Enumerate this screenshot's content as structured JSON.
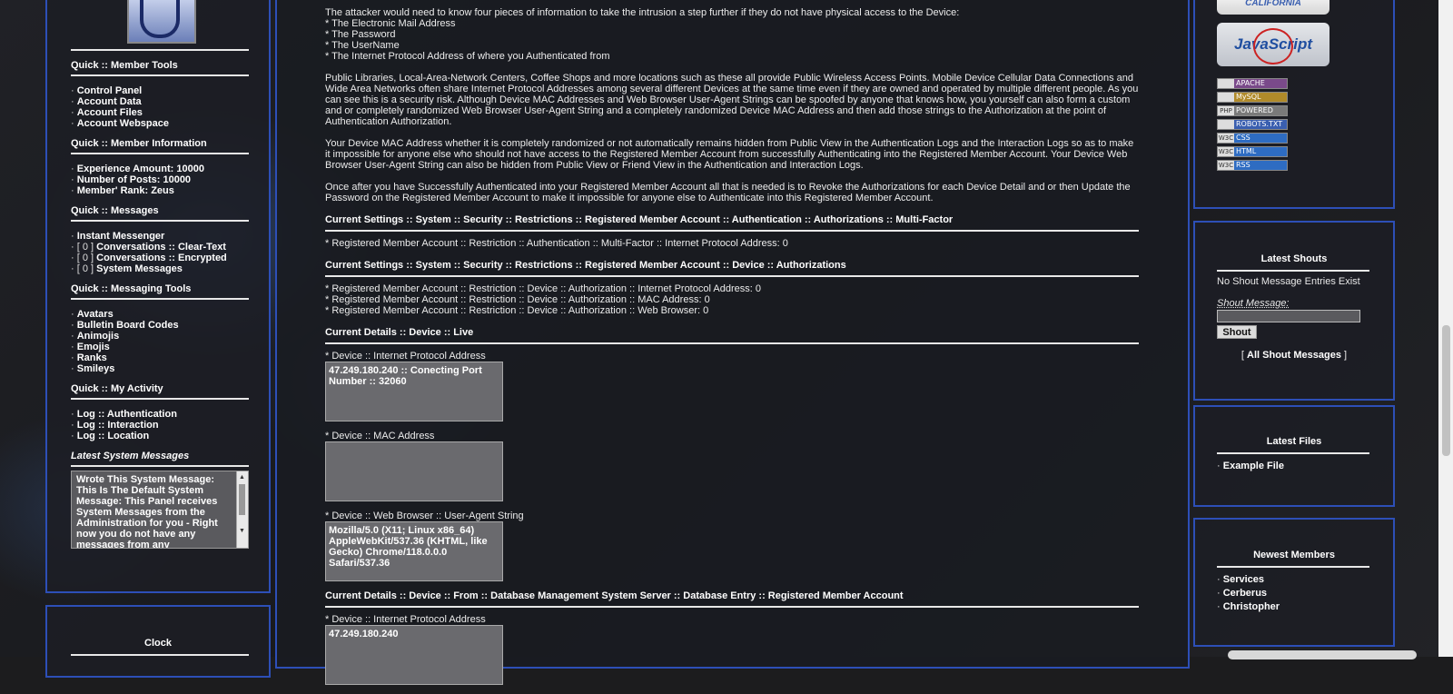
{
  "left": {
    "member_tools": {
      "title": "Quick :: Member Tools",
      "items": [
        "Control Panel",
        "Account Data",
        "Account Files",
        "Account Webspace"
      ]
    },
    "member_info": {
      "title": "Quick :: Member Information",
      "items": [
        "Experience Amount: 10000",
        "Number of Posts: 10000",
        "Member' Rank: Zeus"
      ]
    },
    "messages": {
      "title": "Quick :: Messages",
      "instant": "Instant Messenger",
      "clear": {
        "count": "[ 0 ]",
        "label": "Conversations :: Clear-Text"
      },
      "encrypted": {
        "count": "[ 0 ]",
        "label": "Conversations :: Encrypted"
      },
      "system": {
        "count": "[ 0 ]",
        "label": "System Messages"
      }
    },
    "messaging_tools": {
      "title": "Quick :: Messaging Tools",
      "items": [
        "Avatars",
        "Bulletin Board Codes",
        "Animojis",
        "Emojis",
        "Ranks",
        "Smileys"
      ]
    },
    "activity": {
      "title": "Quick :: My Activity",
      "items": [
        "Log :: Authentication",
        "Log :: Interaction",
        "Log :: Location"
      ]
    },
    "system_messages": {
      "title": "Latest System Messages",
      "text": "Wrote This System Message: This Is The Default System Message: This Panel receives System Messages from the Administration for you - Right now you do not have any messages from any"
    },
    "clock_title": "Clock"
  },
  "content": {
    "intro": "The attacker would need to know four pieces of information to take the intrusion a step further if they do not have physical access to the Device:",
    "bullets": [
      "* The Electronic Mail Address",
      "* The Password",
      "* The UserName",
      "* The Internet Protocol Address of where you Authenticated from"
    ],
    "para_public": "Public Libraries, Local-Area-Network Centers, Coffee Shops and more locations such as these all provide Public Wireless Access Points. Mobile Device Cellular Data Connections and Wide Area Networks often share Internet Protocol Addresses among several different Devices at the same time even if they are owned and operated by multiple different people. As you can see this is a security risk. Although Device MAC Addresses and Web Browser User-Agent Strings can be spoofed by anyone that knows how, you yourself can also form a custom and or completely randomized Web Browser User-Agent String and a completely randomized Device MAC Address and then add those strings to the Authorization at the point of Authentication Authorization.",
    "para_mac": "Your Device MAC Address whether it is completely randomized or not automatically remains hidden from Public View in the Authentication Logs and the Interaction Logs so as to make it impossible for anyone else who should not have access to the Registered Member Account from successfully Authenticating into the Registered Member Account. Your Device Web Browser User-Agent String can also be hidden from Public View or Friend View in the Authentication and Interaction Logs.",
    "para_once": "Once after you have Successfully Authenticated into your Registered Member Account all that is needed is to Revoke the Authorizations for each Device Detail and or then Update the Password on the Registered Member Account to make it impossible for anyone else to Authenticate into this Registered Member Account.",
    "hdr_multifactor": "Current Settings :: System :: Security :: Restrictions :: Registered Member Account :: Authentication :: Authorizations :: Multi-Factor",
    "multifactor_line": "* Registered Member Account :: Restriction :: Authentication :: Multi-Factor :: Internet Protocol Address: 0",
    "hdr_device_auth": "Current Settings :: System :: Security :: Restrictions :: Registered Member Account :: Device :: Authorizations",
    "device_auth_lines": [
      "* Registered Member Account :: Restriction :: Device :: Authorization :: Internet Protocol Address: 0",
      "* Registered Member Account :: Restriction :: Device :: Authorization :: MAC Address: 0",
      "* Registered Member Account :: Restriction :: Device :: Authorization :: Web Browser: 0"
    ],
    "hdr_live": "Current Details :: Device :: Live",
    "live_ip_label": "* Device :: Internet Protocol Address",
    "live_ip_value": "47.249.180.240 :: Conecting Port Number :: 32060",
    "live_mac_label": "* Device :: MAC Address",
    "live_mac_value": "",
    "live_ua_label": "* Device :: Web Browser :: User-Agent String",
    "live_ua_value": "Mozilla/5.0 (X11; Linux x86_64) AppleWebKit/537.36 (KHTML, like Gecko) Chrome/118.0.0.0 Safari/537.36",
    "hdr_db": "Current Details :: Device :: From :: Database Management System Server :: Database Entry :: Registered Member Account",
    "db_ip_label": "* Device :: Internet Protocol Address",
    "db_ip_value": "47.249.180.240"
  },
  "right": {
    "badge_california": "CALIFORNIA",
    "badge_javascript": "JavaScript",
    "mini_badges": [
      {
        "left": "",
        "label": "APACHE"
      },
      {
        "left": "",
        "label": "MySQL"
      },
      {
        "left": "PHP",
        "label": "POWERED"
      },
      {
        "left": "",
        "label": "ROBOTS.TXT"
      },
      {
        "left": "W3C",
        "label": "CSS"
      },
      {
        "left": "W3C",
        "label": "HTML"
      },
      {
        "left": "W3C",
        "label": "RSS"
      }
    ],
    "shouts": {
      "title": "Latest Shouts",
      "empty": "No Shout Message Entries Exist",
      "field_label": "Shout Message:",
      "button": "Shout",
      "all_link": "All Shout Messages",
      "all_prefix": "[",
      "all_suffix": "]"
    },
    "files": {
      "title": "Latest Files",
      "items": [
        "Example File"
      ]
    },
    "members": {
      "title": "Newest Members",
      "items": [
        "Services",
        "Cerberus",
        "Christopher"
      ]
    }
  }
}
